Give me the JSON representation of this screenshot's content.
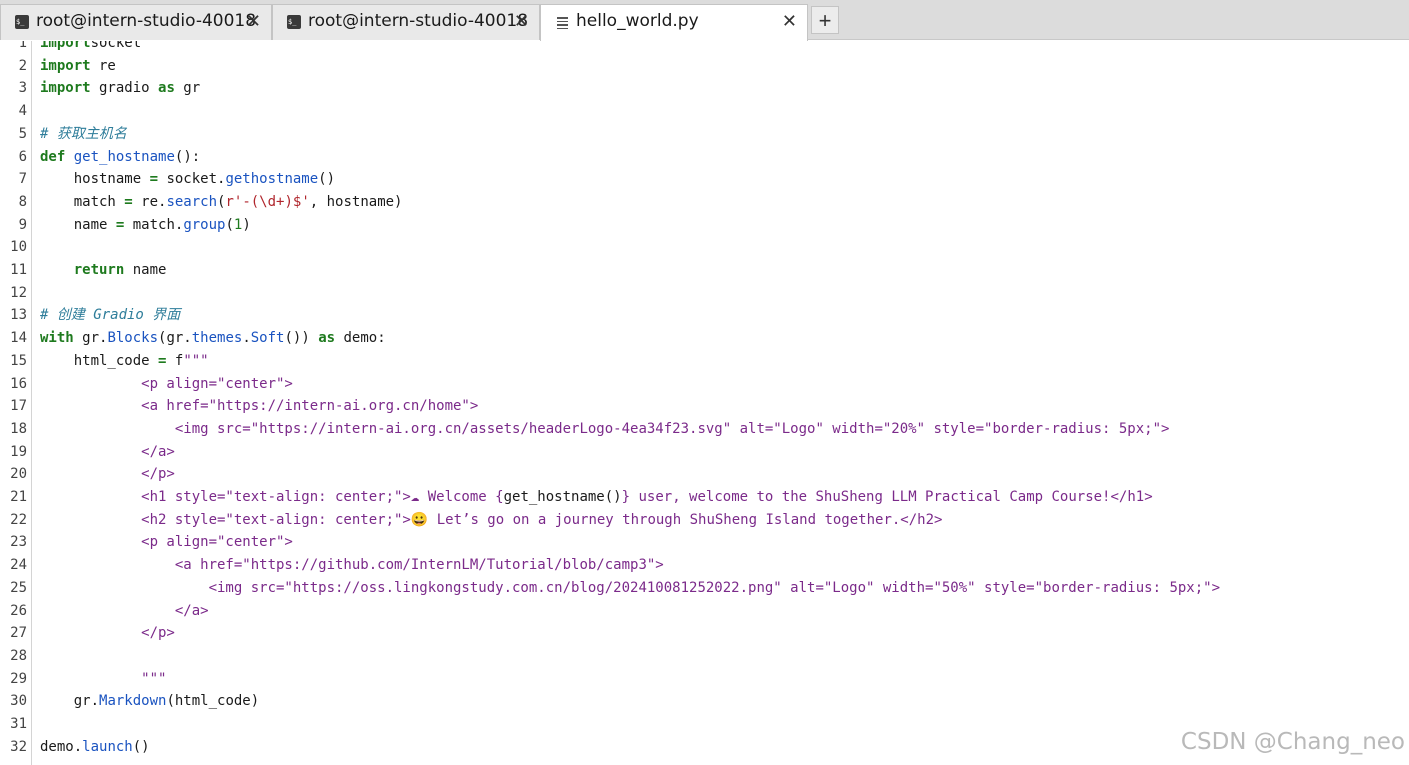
{
  "tabs": [
    {
      "label": "root@intern-studio-40018",
      "icon": "terminal-icon",
      "active": false
    },
    {
      "label": "root@intern-studio-40018",
      "icon": "terminal-icon",
      "active": false
    },
    {
      "label": "hello_world.py",
      "icon": "file-text-icon",
      "active": true
    }
  ],
  "add_tab_label": "+",
  "close_glyph": "✕",
  "terminal_glyph": "$_",
  "watermark": "CSDN @Chang_neo",
  "code_lines": [
    {
      "n": "1",
      "segs": [
        [
          "kw",
          "import"
        ],
        [
          "",
          "socket"
        ]
      ]
    },
    {
      "n": "2",
      "segs": [
        [
          "kw",
          "import"
        ],
        [
          "",
          " re"
        ]
      ]
    },
    {
      "n": "3",
      "segs": [
        [
          "kw",
          "import"
        ],
        [
          "",
          " gradio "
        ],
        [
          "kw",
          "as"
        ],
        [
          "",
          " gr"
        ]
      ]
    },
    {
      "n": "4",
      "segs": []
    },
    {
      "n": "5",
      "segs": [
        [
          "cm",
          "# 获取主机名"
        ]
      ]
    },
    {
      "n": "6",
      "segs": [
        [
          "kw",
          "def"
        ],
        [
          "",
          " "
        ],
        [
          "fn",
          "get_hostname"
        ],
        [
          "",
          "():"
        ]
      ]
    },
    {
      "n": "7",
      "segs": [
        [
          "",
          "    hostname "
        ],
        [
          "kw",
          "="
        ],
        [
          "",
          " socket."
        ],
        [
          "fn",
          "gethostname"
        ],
        [
          "",
          "()"
        ]
      ]
    },
    {
      "n": "8",
      "segs": [
        [
          "",
          "    match "
        ],
        [
          "kw",
          "="
        ],
        [
          "",
          " re."
        ],
        [
          "fn",
          "search"
        ],
        [
          "",
          "("
        ],
        [
          "regex",
          "r'-(\\d+)$'"
        ],
        [
          "",
          ", hostname)"
        ]
      ]
    },
    {
      "n": "9",
      "segs": [
        [
          "",
          "    name "
        ],
        [
          "kw",
          "="
        ],
        [
          "",
          " match."
        ],
        [
          "fn",
          "group"
        ],
        [
          "",
          "("
        ],
        [
          "num",
          "1"
        ],
        [
          "",
          ")"
        ]
      ]
    },
    {
      "n": "10",
      "segs": []
    },
    {
      "n": "11",
      "segs": [
        [
          "",
          "    "
        ],
        [
          "kw",
          "return"
        ],
        [
          "",
          " name"
        ]
      ]
    },
    {
      "n": "12",
      "segs": []
    },
    {
      "n": "13",
      "segs": [
        [
          "cm",
          "# 创建 Gradio 界面"
        ]
      ]
    },
    {
      "n": "14",
      "segs": [
        [
          "kw",
          "with"
        ],
        [
          "",
          " gr."
        ],
        [
          "fn",
          "Blocks"
        ],
        [
          "",
          "(gr."
        ],
        [
          "fn",
          "themes"
        ],
        [
          "",
          "."
        ],
        [
          "fn",
          "Soft"
        ],
        [
          "",
          "()) "
        ],
        [
          "kw",
          "as"
        ],
        [
          "",
          " demo:"
        ]
      ]
    },
    {
      "n": "15",
      "segs": [
        [
          "",
          "    html_code "
        ],
        [
          "kw",
          "="
        ],
        [
          "",
          " f"
        ],
        [
          "str",
          "\"\"\""
        ]
      ]
    },
    {
      "n": "16",
      "segs": [
        [
          "str",
          "            <p align=\"center\">"
        ]
      ]
    },
    {
      "n": "17",
      "segs": [
        [
          "str",
          "            <a href=\"https://intern-ai.org.cn/home\">"
        ]
      ]
    },
    {
      "n": "18",
      "segs": [
        [
          "str",
          "                <img src=\"https://intern-ai.org.cn/assets/headerLogo-4ea34f23.svg\" alt=\"Logo\" width=\"20%\" style=\"border-radius: 5px;\">"
        ]
      ]
    },
    {
      "n": "19",
      "segs": [
        [
          "str",
          "            </a>"
        ]
      ]
    },
    {
      "n": "20",
      "segs": [
        [
          "str",
          "            </p>"
        ]
      ]
    },
    {
      "n": "21",
      "segs": [
        [
          "str",
          "            <h1 style=\"text-align: center;\">☁ Welcome "
        ],
        [
          "brace",
          "{"
        ],
        [
          "",
          "get_hostname()"
        ],
        [
          "brace",
          "}"
        ],
        [
          "str",
          " user, welcome to the ShuSheng LLM Practical Camp Course!</h1>"
        ]
      ]
    },
    {
      "n": "22",
      "segs": [
        [
          "str",
          "            <h2 style=\"text-align: center;\">😀 Let’s go on a journey through ShuSheng Island together.</h2>"
        ]
      ]
    },
    {
      "n": "23",
      "segs": [
        [
          "str",
          "            <p align=\"center\">"
        ]
      ]
    },
    {
      "n": "24",
      "segs": [
        [
          "str",
          "                <a href=\"https://github.com/InternLM/Tutorial/blob/camp3\">"
        ]
      ]
    },
    {
      "n": "25",
      "segs": [
        [
          "str",
          "                    <img src=\"https://oss.lingkongstudy.com.cn/blog/202410081252022.png\" alt=\"Logo\" width=\"50%\" style=\"border-radius: 5px;\">"
        ]
      ]
    },
    {
      "n": "26",
      "segs": [
        [
          "str",
          "                </a>"
        ]
      ]
    },
    {
      "n": "27",
      "segs": [
        [
          "str",
          "            </p>"
        ]
      ]
    },
    {
      "n": "28",
      "segs": []
    },
    {
      "n": "29",
      "segs": [
        [
          "str",
          "            \"\"\""
        ]
      ]
    },
    {
      "n": "30",
      "segs": [
        [
          "",
          "    gr."
        ],
        [
          "fn",
          "Markdown"
        ],
        [
          "",
          "(html_code)"
        ]
      ]
    },
    {
      "n": "31",
      "segs": []
    },
    {
      "n": "32",
      "segs": [
        [
          "",
          "demo."
        ],
        [
          "fn",
          "launch"
        ],
        [
          "",
          "()"
        ]
      ]
    }
  ]
}
